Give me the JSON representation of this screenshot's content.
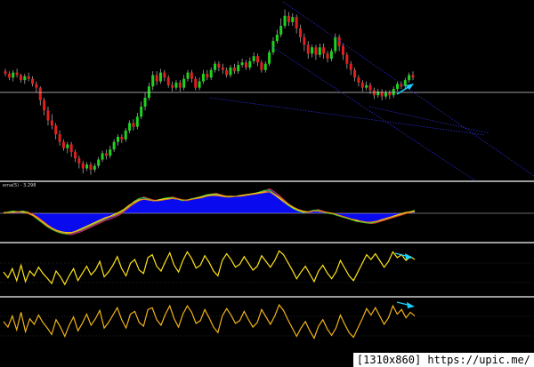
{
  "watermark": "[1310x860] https://upic.me/",
  "colors": {
    "background": "#000000",
    "separator": "#d0d0d0",
    "candle_up": "#1fd21f",
    "candle_down": "#e02020",
    "wick": "#bbbbbb",
    "trendline": "#2a2acc",
    "arrow": "#19d2ff",
    "histogram": "#0a0aee",
    "ind_line_a": "#ffd21a",
    "ind_line_b": "#e08a1a",
    "ind_line_c": "#e03030",
    "ind_line_d": "#2bd12b",
    "level_line": "#d0d0d0"
  },
  "panels": [
    {
      "type": "candlestick",
      "label": ""
    },
    {
      "type": "histogram-with-lines",
      "label": "ema(5) - 3.298"
    },
    {
      "type": "oscillator",
      "label": ""
    },
    {
      "type": "oscillator",
      "label": ""
    }
  ],
  "chart_data": [
    {
      "type": "candlestick",
      "title": "",
      "ohlc": [
        [
          183,
          181,
          185,
          179
        ],
        [
          181,
          178,
          183,
          176
        ],
        [
          178,
          182,
          184,
          175
        ],
        [
          182,
          180,
          185,
          178
        ],
        [
          180,
          176,
          181,
          174
        ],
        [
          176,
          179,
          181,
          173
        ],
        [
          179,
          177,
          182,
          175
        ],
        [
          177,
          173,
          179,
          171
        ],
        [
          173,
          170,
          175,
          166
        ],
        [
          170,
          160,
          171,
          156
        ],
        [
          160,
          152,
          162,
          148
        ],
        [
          152,
          144,
          155,
          140
        ],
        [
          144,
          140,
          149,
          137
        ],
        [
          140,
          133,
          142,
          129
        ],
        [
          133,
          127,
          136,
          124
        ],
        [
          127,
          122,
          129,
          120
        ],
        [
          122,
          125,
          127,
          118
        ],
        [
          125,
          119,
          127,
          115
        ],
        [
          119,
          114,
          121,
          111
        ],
        [
          114,
          110,
          116,
          106
        ],
        [
          110,
          106,
          112,
          102
        ],
        [
          106,
          109,
          111,
          104
        ],
        [
          109,
          105,
          111,
          101
        ],
        [
          105,
          108,
          110,
          103
        ],
        [
          108,
          113,
          115,
          106
        ],
        [
          113,
          118,
          120,
          111
        ],
        [
          118,
          116,
          121,
          113
        ],
        [
          116,
          121,
          124,
          114
        ],
        [
          121,
          127,
          129,
          119
        ],
        [
          127,
          131,
          133,
          124
        ],
        [
          131,
          129,
          133,
          126
        ],
        [
          129,
          136,
          138,
          127
        ],
        [
          136,
          142,
          144,
          134
        ],
        [
          142,
          139,
          145,
          136
        ],
        [
          139,
          147,
          150,
          137
        ],
        [
          147,
          155,
          159,
          145
        ],
        [
          155,
          162,
          166,
          152
        ],
        [
          162,
          171,
          174,
          160
        ],
        [
          171,
          180,
          183,
          168
        ],
        [
          180,
          175,
          183,
          172
        ],
        [
          175,
          182,
          185,
          173
        ],
        [
          182,
          178,
          184,
          175
        ],
        [
          178,
          172,
          180,
          170
        ],
        [
          172,
          170,
          175,
          167
        ],
        [
          170,
          174,
          176,
          168
        ],
        [
          174,
          170,
          176,
          167
        ],
        [
          170,
          177,
          180,
          168
        ],
        [
          177,
          182,
          184,
          175
        ],
        [
          182,
          177,
          184,
          174
        ],
        [
          177,
          170,
          179,
          168
        ],
        [
          170,
          175,
          178,
          168
        ],
        [
          175,
          181,
          184,
          173
        ],
        [
          181,
          178,
          184,
          176
        ],
        [
          178,
          184,
          186,
          176
        ],
        [
          184,
          189,
          191,
          182
        ],
        [
          189,
          186,
          191,
          183
        ],
        [
          186,
          184,
          189,
          181
        ],
        [
          184,
          180,
          186,
          178
        ],
        [
          180,
          186,
          188,
          178
        ],
        [
          186,
          183,
          189,
          181
        ],
        [
          183,
          188,
          191,
          181
        ],
        [
          188,
          190,
          193,
          186
        ],
        [
          190,
          186,
          192,
          184
        ],
        [
          186,
          191,
          194,
          184
        ],
        [
          191,
          195,
          198,
          189
        ],
        [
          195,
          190,
          197,
          187
        ],
        [
          190,
          184,
          192,
          182
        ],
        [
          184,
          189,
          191,
          182
        ],
        [
          189,
          198,
          200,
          187
        ],
        [
          198,
          207,
          210,
          196
        ],
        [
          207,
          212,
          216,
          205
        ],
        [
          212,
          219,
          225,
          210
        ],
        [
          219,
          227,
          232,
          217
        ],
        [
          227,
          222,
          230,
          219
        ],
        [
          222,
          226,
          229,
          219
        ],
        [
          226,
          217,
          228,
          213
        ],
        [
          217,
          210,
          220,
          206
        ],
        [
          210,
          204,
          213,
          199
        ],
        [
          204,
          197,
          207,
          193
        ],
        [
          197,
          202,
          204,
          194
        ],
        [
          202,
          196,
          204,
          192
        ],
        [
          196,
          202,
          205,
          194
        ],
        [
          202,
          197,
          205,
          193
        ],
        [
          197,
          193,
          199,
          190
        ],
        [
          193,
          199,
          201,
          191
        ],
        [
          199,
          210,
          213,
          197
        ],
        [
          210,
          203,
          212,
          199
        ],
        [
          203,
          196,
          205,
          192
        ],
        [
          196,
          189,
          198,
          185
        ],
        [
          189,
          184,
          191,
          180
        ],
        [
          184,
          178,
          186,
          175
        ],
        [
          178,
          174,
          180,
          171
        ],
        [
          174,
          170,
          176,
          167
        ],
        [
          170,
          172,
          175,
          168
        ],
        [
          172,
          168,
          174,
          165
        ],
        [
          168,
          164,
          170,
          161
        ],
        [
          164,
          167,
          169,
          162
        ],
        [
          167,
          163,
          169,
          160
        ],
        [
          163,
          166,
          168,
          161
        ],
        [
          166,
          164,
          168,
          161
        ],
        [
          164,
          169,
          171,
          162
        ],
        [
          169,
          173,
          175,
          167
        ],
        [
          173,
          171,
          175,
          169
        ],
        [
          171,
          176,
          178,
          169
        ],
        [
          176,
          180,
          182,
          174
        ],
        [
          180,
          178,
          183,
          176
        ]
      ],
      "trendlines": [
        "upper channel line",
        "lower channel line",
        "support line",
        "support parallel line"
      ],
      "horizontal_levels": [
        "price level line"
      ],
      "annotations": [
        "upward arrow near last bars"
      ]
    },
    {
      "type": "area",
      "series": [
        {
          "values": [
            0,
            1,
            2,
            1,
            3,
            2,
            -1,
            -5,
            -10,
            -15,
            -20,
            -24,
            -26,
            -28,
            -29,
            -27,
            -25,
            -22,
            -19,
            -16,
            -13,
            -10,
            -8,
            -5,
            -2,
            3,
            8,
            14,
            19,
            22,
            20,
            18,
            17,
            19,
            21,
            22,
            20,
            18,
            17,
            19,
            20,
            22,
            24,
            26,
            27,
            25,
            23,
            22,
            23,
            24,
            25,
            26,
            27,
            28,
            30,
            33,
            29,
            24,
            18,
            12,
            8,
            4,
            2,
            1,
            3,
            5,
            3,
            1,
            0,
            -2,
            -4,
            -6,
            -8,
            -10,
            -12,
            -13,
            -14,
            -13,
            -11,
            -9,
            -7,
            -5,
            -3,
            -1,
            1,
            3
          ]
        },
        {
          "values": [
            0,
            2,
            3,
            2,
            3,
            1,
            -3,
            -8,
            -13,
            -18,
            -22,
            -25,
            -27,
            -28,
            -27,
            -25,
            -22,
            -19,
            -16,
            -13,
            -10,
            -7,
            -5,
            -2,
            1,
            5,
            10,
            16,
            20,
            21,
            19,
            17,
            18,
            20,
            21,
            21,
            19,
            17,
            18,
            20,
            21,
            23,
            25,
            26,
            26,
            24,
            22,
            22,
            23,
            24,
            25,
            26,
            27,
            29,
            31,
            31,
            26,
            21,
            15,
            10,
            6,
            3,
            1,
            2,
            4,
            4,
            2,
            0,
            -1,
            -3,
            -5,
            -7,
            -9,
            -11,
            -12,
            -13,
            -13,
            -12,
            -10,
            -8,
            -6,
            -4,
            -2,
            0,
            2,
            4
          ]
        },
        {
          "values": [
            1,
            1,
            2,
            2,
            2,
            0,
            -2,
            -6,
            -11,
            -16,
            -20,
            -23,
            -25,
            -26,
            -26,
            -24,
            -21,
            -18,
            -15,
            -12,
            -9,
            -6,
            -4,
            -1,
            2,
            6,
            11,
            15,
            18,
            19,
            18,
            17,
            18,
            19,
            20,
            20,
            19,
            18,
            18,
            19,
            21,
            22,
            24,
            25,
            25,
            24,
            23,
            23,
            23,
            24,
            25,
            26,
            27,
            28,
            29,
            29,
            25,
            20,
            15,
            11,
            7,
            4,
            2,
            2,
            3,
            3,
            2,
            1,
            0,
            -2,
            -4,
            -6,
            -8,
            -10,
            -11,
            -12,
            -12,
            -11,
            -9,
            -7,
            -5,
            -3,
            -1,
            1,
            2,
            3
          ]
        },
        {
          "values": [
            0,
            1,
            1,
            2,
            1,
            0,
            -3,
            -7,
            -12,
            -17,
            -21,
            -24,
            -26,
            -27,
            -27,
            -25,
            -23,
            -20,
            -17,
            -14,
            -11,
            -8,
            -5,
            -3,
            0,
            4,
            9,
            13,
            17,
            19,
            18,
            17,
            17,
            18,
            19,
            20,
            19,
            18,
            18,
            19,
            20,
            21,
            23,
            24,
            24,
            23,
            22,
            22,
            23,
            23,
            24,
            25,
            26,
            27,
            28,
            29,
            26,
            22,
            17,
            12,
            8,
            5,
            3,
            2,
            3,
            3,
            2,
            1,
            0,
            -2,
            -4,
            -6,
            -8,
            -9,
            -11,
            -12,
            -12,
            -11,
            -10,
            -8,
            -6,
            -4,
            -2,
            0,
            1,
            2
          ]
        }
      ]
    },
    {
      "type": "line",
      "series": [
        {
          "values": [
            48,
            36,
            55,
            30,
            62,
            28,
            50,
            40,
            58,
            45,
            35,
            24,
            50,
            38,
            22,
            40,
            55,
            30,
            45,
            60,
            42,
            52,
            70,
            38,
            48,
            62,
            80,
            55,
            40,
            66,
            74,
            52,
            45,
            78,
            84,
            60,
            50,
            70,
            88,
            62,
            48,
            72,
            90,
            76,
            56,
            62,
            82,
            68,
            50,
            40,
            72,
            86,
            74,
            58,
            64,
            80,
            66,
            52,
            60,
            82,
            70,
            58,
            72,
            92,
            84,
            68,
            52,
            34,
            48,
            60,
            44,
            28,
            50,
            62,
            46,
            34,
            48,
            72,
            56,
            40,
            30,
            48,
            66,
            84,
            74,
            86,
            72,
            58,
            70,
            90,
            78,
            84,
            72,
            80,
            74
          ]
        }
      ]
    },
    {
      "type": "line",
      "series": [
        {
          "values": [
            58,
            46,
            70,
            40,
            78,
            36,
            64,
            52,
            72,
            56,
            44,
            30,
            62,
            46,
            26,
            50,
            68,
            38,
            54,
            74,
            50,
            64,
            82,
            44,
            56,
            72,
            88,
            62,
            44,
            74,
            80,
            56,
            48,
            84,
            88,
            62,
            50,
            74,
            92,
            64,
            46,
            74,
            92,
            78,
            54,
            60,
            84,
            66,
            46,
            34,
            70,
            86,
            72,
            54,
            60,
            80,
            62,
            46,
            56,
            84,
            68,
            52,
            70,
            94,
            82,
            62,
            44,
            26,
            44,
            58,
            38,
            22,
            48,
            62,
            42,
            28,
            44,
            72,
            52,
            34,
            24,
            44,
            64,
            86,
            72,
            88,
            70,
            52,
            66,
            92,
            74,
            84,
            66,
            78,
            70
          ]
        }
      ]
    }
  ]
}
